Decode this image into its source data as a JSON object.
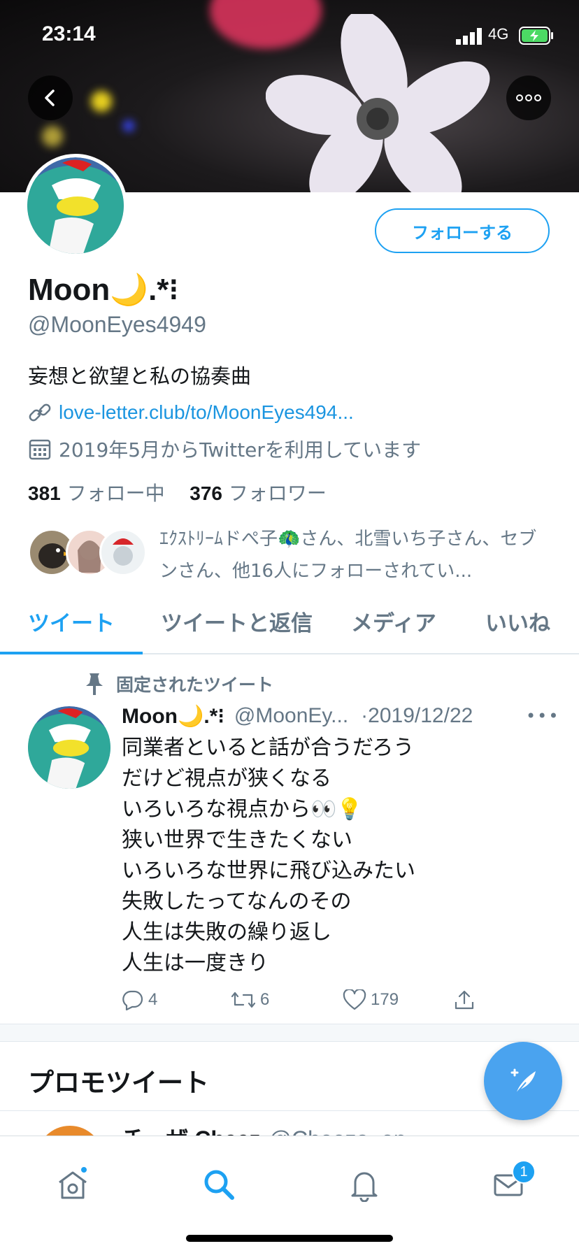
{
  "status_bar": {
    "time": "23:14",
    "network": "4G"
  },
  "profile": {
    "name": "Moon🌙.*⁝",
    "handle": "@MoonEyes4949",
    "bio": "妄想と欲望と私の協奏曲",
    "link": "love-letter.club/to/MoonEyes494...",
    "joined": "2019年5月からTwitterを利用しています",
    "following_count": "381",
    "following_label": "フォロー中",
    "followers_count": "376",
    "followers_label": "フォロワー",
    "followed_by": "ｴｸｽﾄﾘｰﾑドぺ子🦚さん、北雪いち子さん、セブンさん、他16人にフォローされてい..."
  },
  "follow_button": "フォローする",
  "tabs": [
    {
      "label": "ツイート",
      "active": true
    },
    {
      "label": "ツイートと返信"
    },
    {
      "label": "メディア"
    },
    {
      "label": "いいね"
    }
  ],
  "pinned_tweet": {
    "pinned_label": "固定されたツイート",
    "author_name": "Moon🌙.*⁝",
    "author_handle": "@MoonEy...",
    "date": "·2019/12/22",
    "lines": [
      "同業者といると話が合うだろう",
      "だけど視点が狭くなる",
      "いろいろな視点から👀💡",
      "狭い世界で生きたくない",
      "いろいろな世界に飛び込みたい",
      "失敗したってなんのその",
      "人生は失敗の繰り返し",
      "人生は一度きり"
    ],
    "replies": "4",
    "retweets": "6",
    "likes": "179"
  },
  "promo": {
    "title": "プロモツイート",
    "peek_name": "チーザ Cheez",
    "peek_handle": "@Cheeza_en"
  },
  "tabbar": {
    "messages_badge": "1"
  },
  "colors": {
    "accent": "#1da1f2",
    "secondary_text": "#657786",
    "fab": "#4aa3ef"
  }
}
